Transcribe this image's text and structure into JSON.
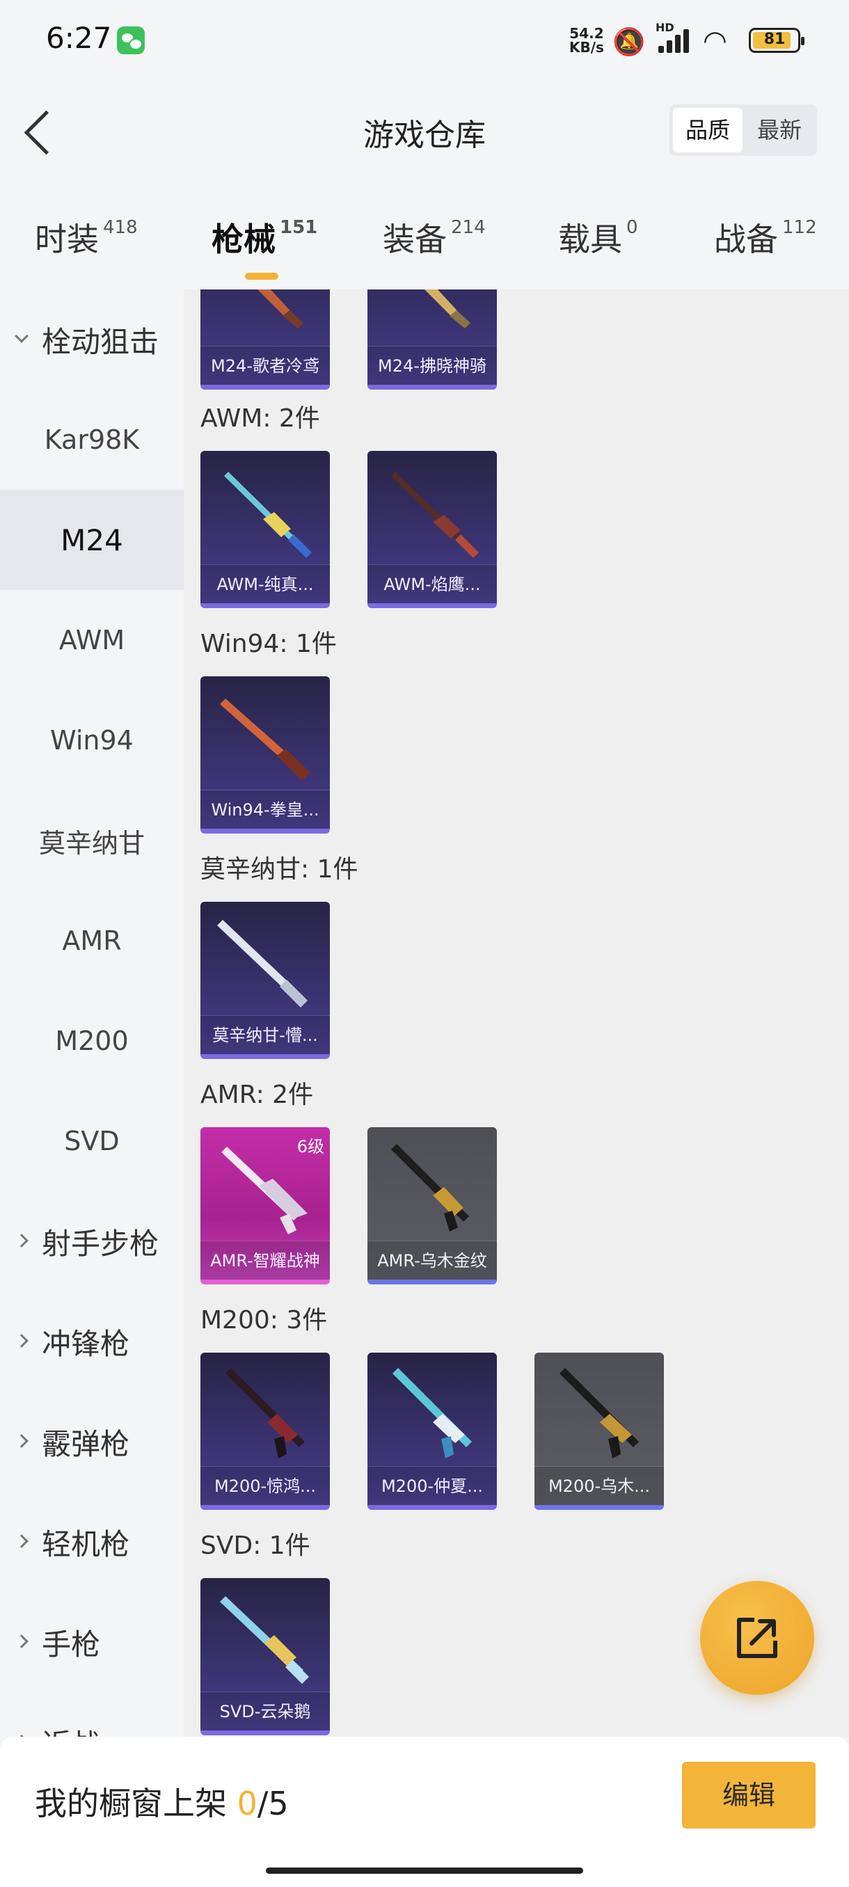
{
  "status": {
    "time": "6:27",
    "net_speed": "54.2",
    "net_unit": "KB/s",
    "hd": "HD",
    "battery": "81"
  },
  "header": {
    "title": "游戏仓库",
    "sort_quality": "品质",
    "sort_newest": "最新"
  },
  "tabs": [
    {
      "label": "时装",
      "count": "418"
    },
    {
      "label": "枪械",
      "count": "151"
    },
    {
      "label": "装备",
      "count": "214"
    },
    {
      "label": "载具",
      "count": "0"
    },
    {
      "label": "战备",
      "count": "112"
    }
  ],
  "sidebar": {
    "items": [
      {
        "label": "栓动狙击"
      },
      {
        "label": "Kar98K"
      },
      {
        "label": "M24"
      },
      {
        "label": "AWM"
      },
      {
        "label": "Win94"
      },
      {
        "label": "莫辛纳甘"
      },
      {
        "label": "AMR"
      },
      {
        "label": "M200"
      },
      {
        "label": "SVD"
      },
      {
        "label": "射手步枪"
      },
      {
        "label": "冲锋枪"
      },
      {
        "label": "霰弹枪"
      },
      {
        "label": "轻机枪"
      },
      {
        "label": "手枪"
      },
      {
        "label": "近战"
      }
    ]
  },
  "content": {
    "top_cards": [
      {
        "name": "M24-歌者冷鸢"
      },
      {
        "name": "M24-拂晓神骑"
      }
    ],
    "sections": [
      {
        "label": "AWM: 2件",
        "cards": [
          {
            "name": "AWM-纯真..."
          },
          {
            "name": "AWM-焰鹰..."
          }
        ]
      },
      {
        "label": "Win94: 1件",
        "cards": [
          {
            "name": "Win94-拳皇..."
          }
        ]
      },
      {
        "label": "莫辛纳甘: 1件",
        "cards": [
          {
            "name": "莫辛纳甘-懵..."
          }
        ]
      },
      {
        "label": "AMR: 2件",
        "cards": [
          {
            "name": "AMR-智耀战神",
            "level": "6级"
          },
          {
            "name": "AMR-乌木金纹"
          }
        ]
      },
      {
        "label": "M200: 3件",
        "cards": [
          {
            "name": "M200-惊鸿..."
          },
          {
            "name": "M200-仲夏..."
          },
          {
            "name": "M200-乌木..."
          }
        ]
      },
      {
        "label": "SVD: 1件",
        "cards": [
          {
            "name": "SVD-云朵鹅"
          }
        ]
      }
    ]
  },
  "bottom": {
    "label": "我的橱窗上架",
    "count": "0",
    "total": "/5",
    "edit_label": "编辑"
  },
  "colors": {
    "accent": "#f2b235",
    "card_purple": "#3d3577",
    "card_magenta": "#c32da8",
    "card_grey": "#55555c"
  }
}
